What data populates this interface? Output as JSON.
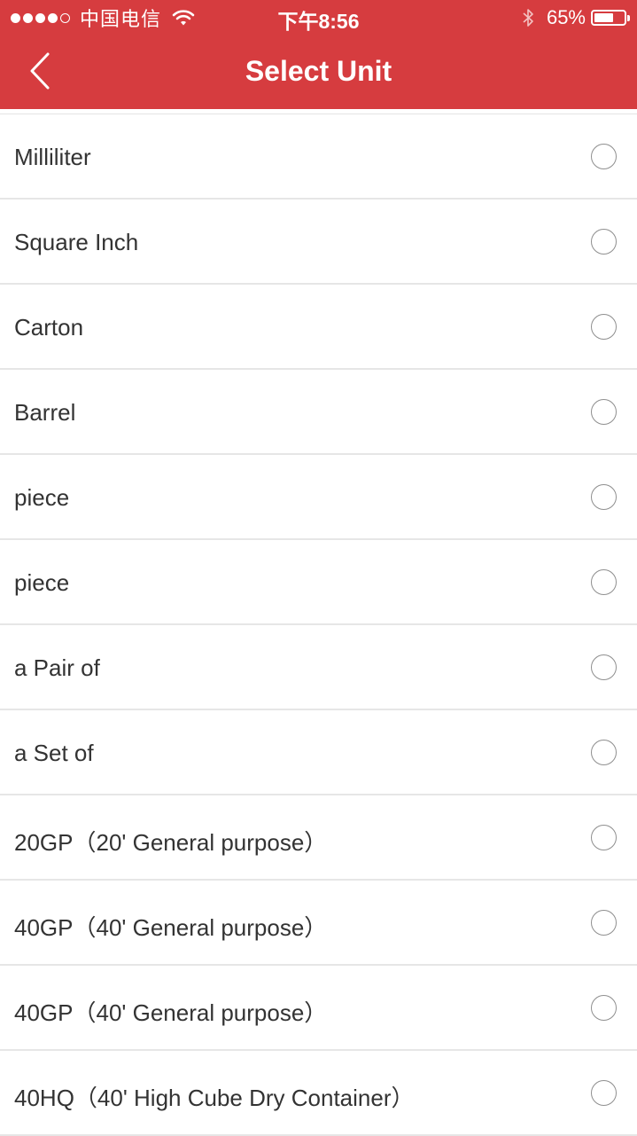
{
  "status_bar": {
    "carrier": "中国电信",
    "time": "下午8:56",
    "battery_percent": "65%",
    "battery_level": 0.65,
    "signal_bars_filled": 4,
    "signal_bars_total": 5
  },
  "nav": {
    "title": "Select Unit",
    "back_icon": "chevron-left-icon"
  },
  "colors": {
    "header_bg": "#d63c3f",
    "divider": "#e6e6e6",
    "text": "#333333",
    "radio_border": "#8f8f8f"
  },
  "units": [
    {
      "label": "Milliliter",
      "selected": false
    },
    {
      "label": "Square Inch",
      "selected": false
    },
    {
      "label": "Carton",
      "selected": false
    },
    {
      "label": "Barrel",
      "selected": false
    },
    {
      "label": "piece",
      "selected": false
    },
    {
      "label": "piece",
      "selected": false
    },
    {
      "label": "a Pair of",
      "selected": false
    },
    {
      "label": "a Set of",
      "selected": false
    },
    {
      "label": "20GP（20' General purpose）",
      "selected": false
    },
    {
      "label": "40GP（40' General purpose）",
      "selected": false
    },
    {
      "label": "40GP（40' General purpose）",
      "selected": false
    },
    {
      "label": "40HQ（40' High Cube Dry Container）",
      "selected": false
    }
  ]
}
